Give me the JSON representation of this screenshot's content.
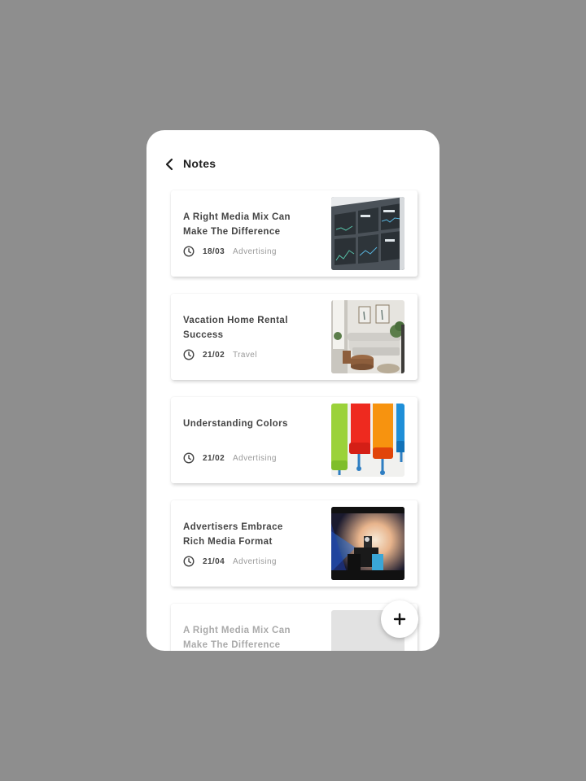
{
  "header": {
    "title": "Notes",
    "back_icon": "chevron-left-icon"
  },
  "notes": [
    {
      "title": "A Right Media Mix Can Make The Difference",
      "date": "18/03",
      "category": "Advertising",
      "image": "dashboard-screens-photo"
    },
    {
      "title": "Vacation Home Rental Success",
      "date": "21/02",
      "category": "Travel",
      "image": "living-room-photo"
    },
    {
      "title": "Understanding Colors",
      "date": "21/02",
      "category": "Advertising",
      "image": "paint-rollers-photo"
    },
    {
      "title": "Advertisers Embrace Rich Media Format",
      "date": "21/04",
      "category": "Advertising",
      "image": "stage-lights-photo"
    },
    {
      "title": "A Right Media Mix Can Make The Difference",
      "date": "",
      "category": "",
      "image": "placeholder"
    }
  ],
  "fab": {
    "label": "+",
    "icon": "plus-icon"
  },
  "colors": {
    "background": "#8e8e8e",
    "card_text": "#444444",
    "muted_text": "#9a9a9a"
  }
}
